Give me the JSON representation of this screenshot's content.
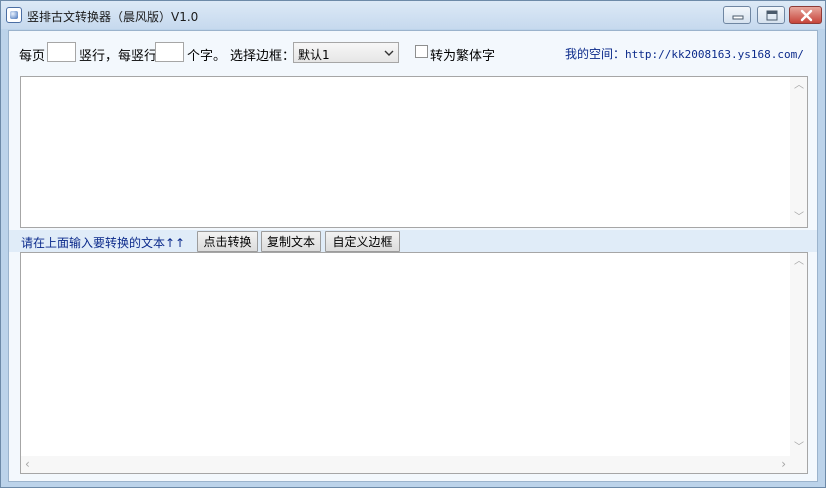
{
  "window": {
    "title": "竖排古文转换器（晨风版）V1.0",
    "controls": [
      "minimize",
      "maximize",
      "close"
    ]
  },
  "toolbar": {
    "label_per_page": "每页",
    "label_columns_each": "竖行，每竖行",
    "label_chars": "个字。",
    "label_select_border": "选择边框：",
    "columns_value": "",
    "chars_value": "",
    "border_selected": "默认1",
    "traditional_label": "转为繁体字",
    "traditional_checked": false,
    "space_label": "我的空间：",
    "space_url": "http://kk2008163.ys168.com/"
  },
  "input_area": {
    "value": ""
  },
  "midbar": {
    "hint": "请在上面输入要转换的文本↑↑",
    "convert_button": "点击转换",
    "copy_button": "复制文本",
    "custom_border_button": "自定义边框"
  },
  "output_area": {
    "value": ""
  },
  "icons": {
    "app": "app-icon",
    "minimize": "minimize-icon",
    "maximize": "maximize-icon",
    "close": "close-icon",
    "dropdown": "chevron-down-icon"
  },
  "colors": {
    "client_bg": "#f3f8fd",
    "link": "#0b2a8b",
    "close_button": "#c6443a"
  }
}
